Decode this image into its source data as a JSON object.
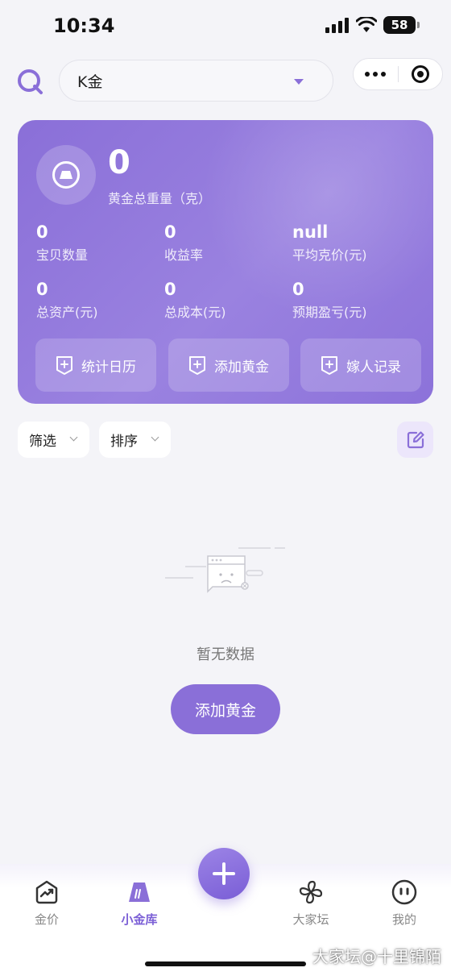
{
  "status_bar": {
    "time": "10:34",
    "battery": "58"
  },
  "header": {
    "selected_type": "K金"
  },
  "summary": {
    "total_weight_value": "0",
    "total_weight_label": "黄金总重量（克）",
    "stats": [
      {
        "value": "0",
        "label": "宝贝数量"
      },
      {
        "value": "0",
        "label": "收益率"
      },
      {
        "value": "null",
        "label": "平均克价(元)"
      },
      {
        "value": "0",
        "label": "总资产(元)"
      },
      {
        "value": "0",
        "label": "总成本(元)"
      },
      {
        "value": "0",
        "label": "预期盈亏(元)"
      }
    ],
    "buttons": [
      {
        "label": "统计日历",
        "icon": "calendar-doc-icon"
      },
      {
        "label": "添加黄金",
        "icon": "add-doc-icon"
      },
      {
        "label": "嫁人记录",
        "icon": "record-doc-icon"
      }
    ]
  },
  "filters": {
    "filter_label": "筛选",
    "sort_label": "排序"
  },
  "empty_state": {
    "text": "暂无数据",
    "button_label": "添加黄金"
  },
  "tabbar": {
    "tabs": [
      {
        "label": "金价",
        "icon": "trend-chart-icon",
        "active": false
      },
      {
        "label": "小金库",
        "icon": "gold-bar-icon",
        "active": true
      },
      {
        "label": "大家坛",
        "icon": "pinwheel-icon",
        "active": false
      },
      {
        "label": "我的",
        "icon": "face-icon",
        "active": false
      }
    ],
    "fab_icon": "plus-icon"
  },
  "watermark": "大家坛@十里锦陌",
  "colors": {
    "accent": "#8a6fd8",
    "background": "#f4f4f8"
  }
}
